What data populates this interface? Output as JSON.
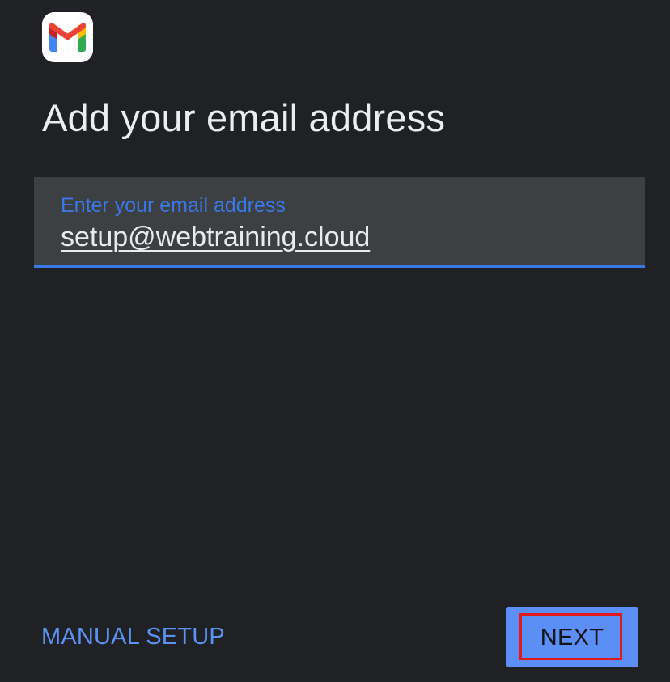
{
  "app": {
    "icon": "gmail-icon",
    "icon_colors": {
      "blue": "#4285F4",
      "green": "#34A853",
      "yellow": "#FBBC04",
      "red": "#EA4335"
    }
  },
  "header": {
    "title": "Add your email address"
  },
  "email_field": {
    "label": "Enter your email address",
    "value": "setup@webtraining.cloud"
  },
  "footer": {
    "manual_setup_label": "MANUAL SETUP",
    "next_label": "NEXT"
  },
  "colors": {
    "background": "#202124",
    "field_background": "#3c4043",
    "accent": "#3b78e7",
    "button": "#5b8ff5",
    "highlight": "#e01a1a"
  }
}
